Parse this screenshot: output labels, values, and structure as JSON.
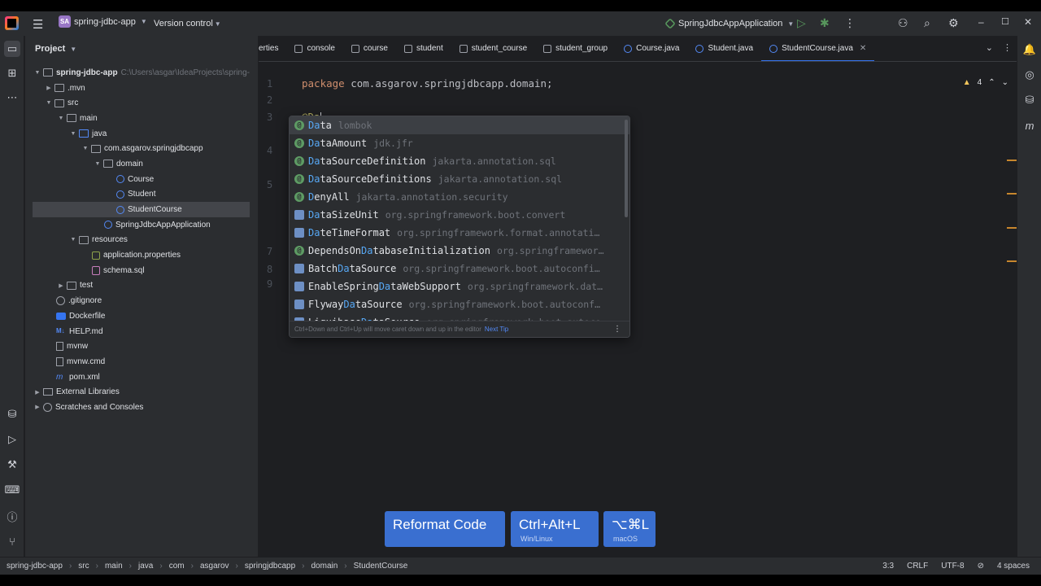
{
  "titlebar": {
    "project_badge": "SA",
    "project_name": "spring-jdbc-app",
    "version_control": "Version control",
    "run_config": "SpringJdbcAppApplication"
  },
  "project_panel": {
    "title": "Project",
    "root": {
      "name": "spring-jdbc-app",
      "path": "C:\\Users\\asgar\\IdeaProjects\\spring-"
    },
    "items": {
      "mvn": ".mvn",
      "src": "src",
      "main": "main",
      "java": "java",
      "package": "com.asgarov.springjdbcapp",
      "domain": "domain",
      "course": "Course",
      "student": "Student",
      "student_course": "StudentCourse",
      "app": "SpringJdbcAppApplication",
      "resources": "resources",
      "app_props": "application.properties",
      "schema": "schema.sql",
      "test": "test",
      "gitignore": ".gitignore",
      "dockerfile": "Dockerfile",
      "help": "HELP.md",
      "help_badge": "M↓",
      "mvnw": "mvnw",
      "mvnw_cmd": "mvnw.cmd",
      "pom": "pom.xml",
      "pom_badge": "m",
      "ext_libs": "External Libraries",
      "scratches": "Scratches and Consoles"
    }
  },
  "tabs": [
    {
      "label": "erties"
    },
    {
      "label": "console"
    },
    {
      "label": "course"
    },
    {
      "label": "student"
    },
    {
      "label": "student_course"
    },
    {
      "label": "student_group"
    },
    {
      "label": "Course.java"
    },
    {
      "label": "Student.java"
    },
    {
      "label": "StudentCourse.java"
    }
  ],
  "editor": {
    "line_numbers": [
      "1",
      "2",
      "3"
    ],
    "line1_keyword": "package",
    "line1_rest": " com.asgarov.springjdbcapp.domain;",
    "line3_typed": "@Da",
    "hidden_line_numbers": [
      "4",
      "5",
      "7",
      "8",
      "9"
    ],
    "warnings_count": "4"
  },
  "completion": {
    "items": [
      {
        "pre": "",
        "match": "Da",
        "post": "ta",
        "source": "lombok",
        "kind": "annotation"
      },
      {
        "pre": "",
        "match": "Da",
        "post": "taAmount",
        "source": "jdk.jfr",
        "kind": "annotation"
      },
      {
        "pre": "",
        "match": "Da",
        "post": "taSourceDefinition",
        "source": "jakarta.annotation.sql",
        "kind": "annotation"
      },
      {
        "pre": "",
        "match": "Da",
        "post": "taSourceDefinitions",
        "source": "jakarta.annotation.sql",
        "kind": "annotation"
      },
      {
        "pre": "",
        "match": "D",
        "post": "enyAll",
        "source": "jakarta.annotation.security",
        "kind": "annotation"
      },
      {
        "pre": "",
        "match": "Da",
        "post": "taSizeUnit",
        "source": "org.springframework.boot.convert",
        "kind": "class"
      },
      {
        "pre": "",
        "match": "Da",
        "post": "teTimeFormat",
        "source": "org.springframework.format.annotati…",
        "kind": "class"
      },
      {
        "pre": "DependsOn",
        "match": "Da",
        "post": "tabaseInitialization",
        "source": "org.springframewor…",
        "kind": "annotation"
      },
      {
        "pre": "Batch",
        "match": "Da",
        "post": "taSource",
        "source": "org.springframework.boot.autoconfi…",
        "kind": "class"
      },
      {
        "pre": "EnableSpring",
        "match": "Da",
        "post": "taWebSupport",
        "source": "org.springframework.dat…",
        "kind": "class"
      },
      {
        "pre": "Flyway",
        "match": "Da",
        "post": "taSource",
        "source": "org.springframework.boot.autoconf…",
        "kind": "class"
      },
      {
        "pre": "Liquibase",
        "match": "Da",
        "post": "taSource",
        "source": "org.springframework.boot.autoco…",
        "kind": "class"
      }
    ],
    "footer_text": "Ctrl+Down and Ctrl+Up will move caret down and up in the editor",
    "footer_tip": "Next Tip"
  },
  "keymap": {
    "action": "Reformat Code",
    "win_keys": "Ctrl+Alt+L",
    "win_os": "Win/Linux",
    "mac_keys": "⌥⌘L",
    "mac_os": "macOS"
  },
  "statusbar": {
    "crumbs": [
      "spring-jdbc-app",
      "src",
      "main",
      "java",
      "com",
      "asgarov",
      "springjdbcapp",
      "domain",
      "StudentCourse"
    ],
    "position": "3:3",
    "line_sep": "CRLF",
    "encoding": "UTF-8",
    "indent": "4 spaces"
  },
  "colors": {
    "accent": "#3574f0",
    "keyword": "#cf8e6d",
    "annotation": "#b3ae60",
    "match_highlight": "#57a8f5",
    "warning": "#f2c55c"
  }
}
